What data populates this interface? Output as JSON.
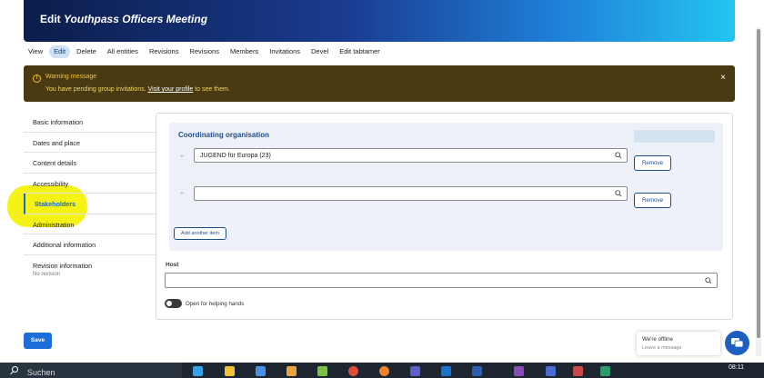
{
  "header": {
    "title_prefix": "Edit ",
    "title_node": "Youthpass Officers Meeting"
  },
  "tabs": [
    {
      "label": "View",
      "active": false
    },
    {
      "label": "Edit",
      "active": true
    },
    {
      "label": "Delete",
      "active": false
    },
    {
      "label": "All entities",
      "active": false
    },
    {
      "label": "Revisions",
      "active": false
    },
    {
      "label": "Revisions",
      "active": false
    },
    {
      "label": "Members",
      "active": false
    },
    {
      "label": "Invitations",
      "active": false
    },
    {
      "label": "Devel",
      "active": false
    },
    {
      "label": "Edit tabtamer",
      "active": false
    }
  ],
  "warning": {
    "title": "Warning message",
    "text_before": "You have pending group invitations. ",
    "link": "Visit your profile",
    "text_after": " to see them.",
    "close": "×"
  },
  "sidebar": {
    "items": [
      {
        "label": "Basic information"
      },
      {
        "label": "Dates and place"
      },
      {
        "label": "Content details"
      },
      {
        "label": "Accessibility"
      },
      {
        "label": "Stakeholders"
      },
      {
        "label": "Administration"
      },
      {
        "label": "Additional information"
      },
      {
        "label": "Revision information",
        "sub": "No revision"
      }
    ]
  },
  "stakeholders": {
    "title": "Coordinating organisation",
    "rows": [
      {
        "value": "JUGEND für Europa (23)",
        "remove": "Remove"
      },
      {
        "value": "",
        "remove": "Remove"
      }
    ],
    "add_label": "Add another item",
    "drag_glyph": "÷"
  },
  "host": {
    "label": "Host",
    "value": ""
  },
  "toggle": {
    "label": "Open for helping hands",
    "on": false
  },
  "save_label": "Save",
  "chat": {
    "status": "We're offline",
    "leave": "Leave a message"
  },
  "taskbar": {
    "search": "Suchen",
    "time": "08:11"
  },
  "colors": {
    "accent": "#1d4f8c",
    "warning_bg": "#493a12",
    "warning_fg": "#f3c23a",
    "highlight": "#f4f20a"
  }
}
